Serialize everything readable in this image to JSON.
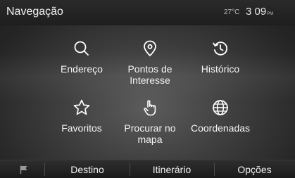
{
  "header": {
    "title": "Navegação",
    "temperature": "27°C",
    "time": "3 09",
    "ampm": "PM"
  },
  "menu": {
    "address": {
      "label": "Endereço",
      "icon": "search-icon"
    },
    "poi": {
      "label": "Pontos de Interesse",
      "icon": "location-pin-icon"
    },
    "history": {
      "label": "Histórico",
      "icon": "history-clock-icon"
    },
    "favorites": {
      "label": "Favoritos",
      "icon": "star-icon"
    },
    "search_map": {
      "label": "Procurar no mapa",
      "icon": "hand-pointer-icon"
    },
    "coordinates": {
      "label": "Coordenadas",
      "icon": "globe-icon"
    }
  },
  "bottom_bar": {
    "flag_icon": "flag-icon",
    "destination": "Destino",
    "route": "Itinerário",
    "options": "Opções"
  },
  "colors": {
    "background": "#3e3e3e",
    "topbar": "#1e1e1e",
    "text": "#ffffff"
  }
}
